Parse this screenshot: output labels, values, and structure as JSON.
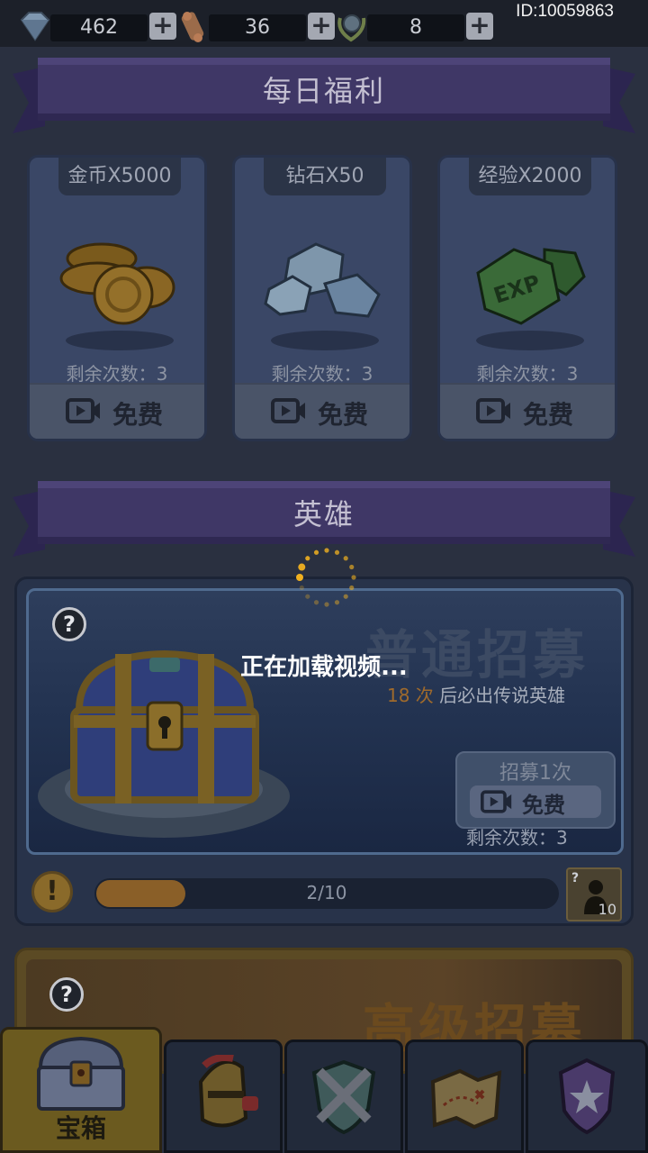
{
  "top_bar": {
    "resources": [
      {
        "icon": "diamond-icon",
        "value": "462"
      },
      {
        "icon": "scroll-icon",
        "value": "36"
      },
      {
        "icon": "laurel-medal-icon",
        "value": "8"
      }
    ],
    "plus_label": "+",
    "user_id": "ID:10059863"
  },
  "daily": {
    "title": "每日福利",
    "cards": [
      {
        "tag": "金币X5000",
        "art": "gold-coins",
        "remaining": "剩余次数：3",
        "button": "免费"
      },
      {
        "tag": "钻石X50",
        "art": "diamonds",
        "remaining": "剩余次数：3",
        "button": "免费"
      },
      {
        "tag": "经验X2000",
        "art": "exp-gems",
        "remaining": "剩余次数：3",
        "button": "免费"
      }
    ]
  },
  "hero": {
    "title": "英雄",
    "normal_recruit": {
      "help": "?",
      "title": "普通招募",
      "guarantee_count": "18 次",
      "guarantee_text": " 后必出传说英雄",
      "button_label": "招募1次",
      "button_free": "免费",
      "remaining": "剩余次数：3",
      "warn": "!",
      "progress_text": "2/10",
      "progress": 0.2,
      "hero_count": "10",
      "hero_help": "?"
    },
    "advanced_recruit": {
      "help": "?",
      "title": "高级招募"
    }
  },
  "overlay": {
    "loading_text": "正在加载视频..."
  },
  "nav": {
    "tabs": [
      {
        "label": "宝箱",
        "icon": "treasure-chest-icon",
        "active": true
      },
      {
        "label": "",
        "icon": "knight-helmet-icon",
        "active": false
      },
      {
        "label": "",
        "icon": "crossed-swords-shield-icon",
        "active": false
      },
      {
        "label": "",
        "icon": "treasure-map-icon",
        "active": false
      },
      {
        "label": "",
        "icon": "guild-banner-icon",
        "active": false
      }
    ]
  },
  "colors": {
    "ribbon": "#3f3766",
    "accent_gold": "#8a5f28",
    "guarantee_highlight": "#9f6a2c"
  }
}
